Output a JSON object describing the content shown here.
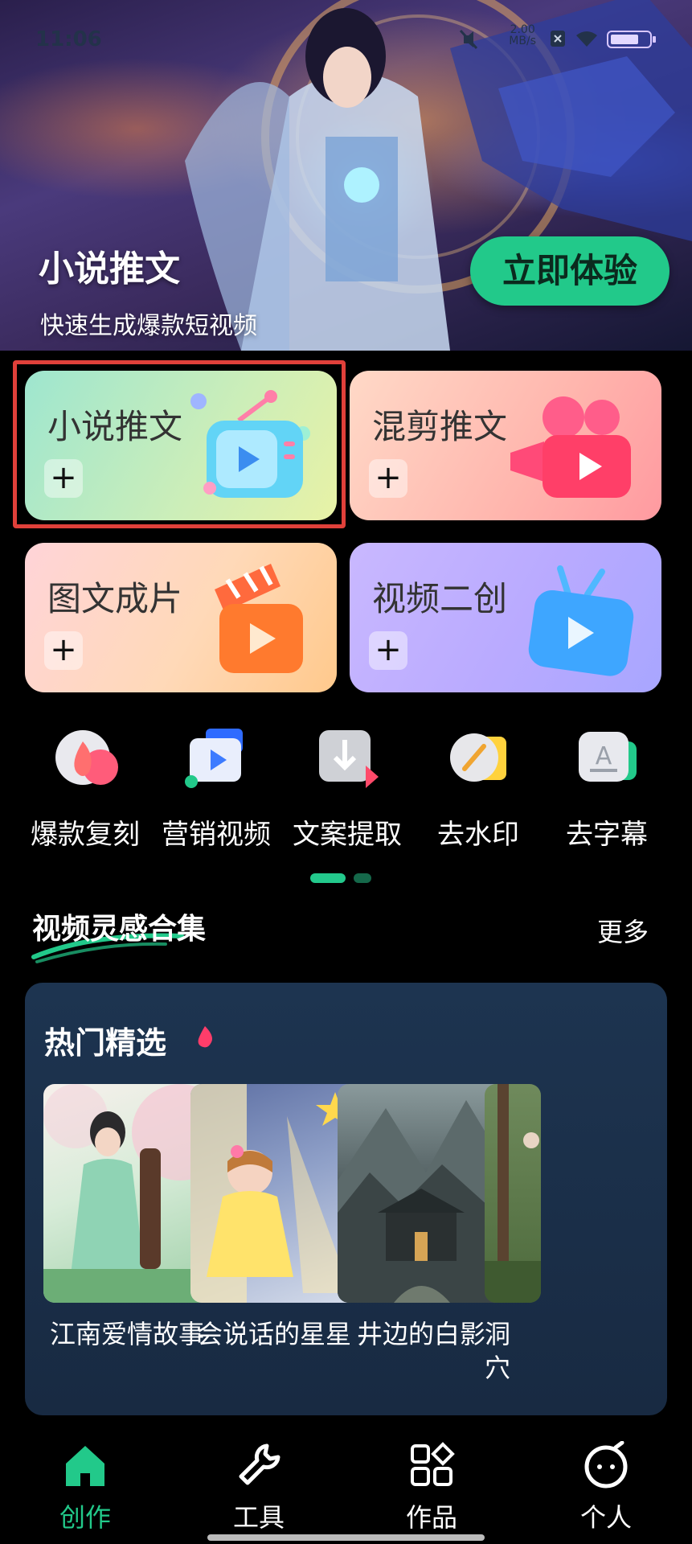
{
  "status_bar": {
    "time": "11:06",
    "net_speed": "2.00",
    "net_unit": "MB/s"
  },
  "hero": {
    "title": "小说推文",
    "subtitle": "快速生成爆款短视频",
    "cta": "立即体验"
  },
  "cards": [
    {
      "label": "小说推文",
      "plus": "+",
      "icon": "tv-play-icon"
    },
    {
      "label": "混剪推文",
      "plus": "+",
      "icon": "video-camera-icon"
    },
    {
      "label": "图文成片",
      "plus": "+",
      "icon": "clapperboard-icon"
    },
    {
      "label": "视频二创",
      "plus": "+",
      "icon": "tv-antenna-icon"
    }
  ],
  "tools": [
    {
      "label": "爆款复刻",
      "icon": "flame-icon"
    },
    {
      "label": "营销视频",
      "icon": "marketing-video-icon"
    },
    {
      "label": "文案提取",
      "icon": "download-icon"
    },
    {
      "label": "去水印",
      "icon": "brush-icon"
    },
    {
      "label": "去字幕",
      "icon": "subtitle-icon"
    }
  ],
  "section": {
    "title": "视频灵感合集",
    "more": "更多"
  },
  "panel": {
    "title": "热门精选",
    "items": [
      {
        "title": "江南爱情故事"
      },
      {
        "title": "会说话的星星"
      },
      {
        "title": "井边的白影"
      },
      {
        "title": "洞穴"
      }
    ]
  },
  "nav": [
    {
      "label": "创作",
      "icon": "home-icon",
      "active": true
    },
    {
      "label": "工具",
      "icon": "wrench-icon"
    },
    {
      "label": "作品",
      "icon": "grid-icon"
    },
    {
      "label": "个人",
      "icon": "face-icon"
    }
  ],
  "colors": {
    "accent": "#22c98a",
    "highlight": "#e0403a",
    "panel": "#1d3450"
  }
}
